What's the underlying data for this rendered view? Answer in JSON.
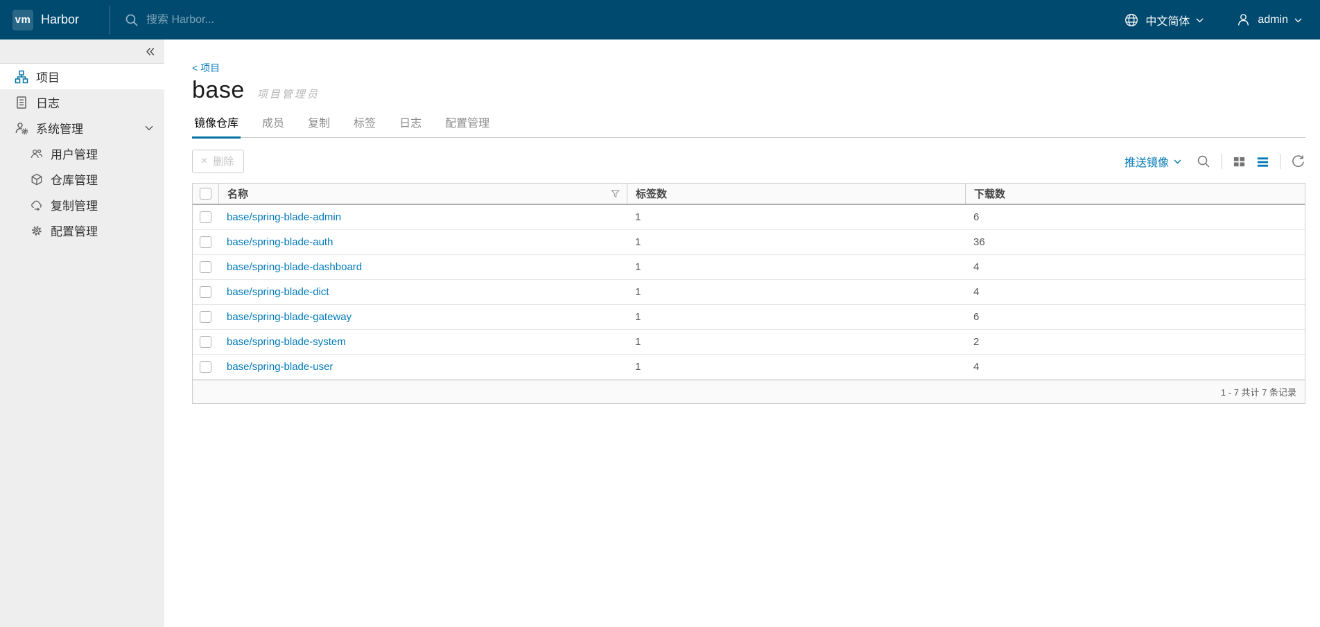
{
  "header": {
    "logo_text": "vm",
    "app_name": "Harbor",
    "search_placeholder": "搜索 Harbor...",
    "language_label": "中文简体",
    "username": "admin"
  },
  "sidebar": {
    "items": [
      {
        "label": "项目",
        "icon": "organization-icon",
        "active": true
      },
      {
        "label": "日志",
        "icon": "log-icon",
        "active": false
      },
      {
        "label": "系统管理",
        "icon": "administration-icon",
        "active": false,
        "expanded": true
      }
    ],
    "sub_items": [
      {
        "label": "用户管理",
        "icon": "users-icon"
      },
      {
        "label": "仓库管理",
        "icon": "registry-icon"
      },
      {
        "label": "复制管理",
        "icon": "replication-icon"
      },
      {
        "label": "配置管理",
        "icon": "config-icon"
      }
    ]
  },
  "page": {
    "breadcrumb": "< 项目",
    "title": "base",
    "role_badge": "项目管理员",
    "tabs": [
      {
        "label": "镜像仓库",
        "active": true
      },
      {
        "label": "成员",
        "active": false
      },
      {
        "label": "复制",
        "active": false
      },
      {
        "label": "标签",
        "active": false
      },
      {
        "label": "日志",
        "active": false
      },
      {
        "label": "配置管理",
        "active": false
      }
    ]
  },
  "toolbar": {
    "delete_label": "删除",
    "push_image_label": "推送镜像"
  },
  "table": {
    "columns": {
      "name": "名称",
      "tags": "标签数",
      "pulls": "下载数"
    },
    "rows": [
      {
        "name": "base/spring-blade-admin",
        "tags": "1",
        "pulls": "6"
      },
      {
        "name": "base/spring-blade-auth",
        "tags": "1",
        "pulls": "36"
      },
      {
        "name": "base/spring-blade-dashboard",
        "tags": "1",
        "pulls": "4"
      },
      {
        "name": "base/spring-blade-dict",
        "tags": "1",
        "pulls": "4"
      },
      {
        "name": "base/spring-blade-gateway",
        "tags": "1",
        "pulls": "6"
      },
      {
        "name": "base/spring-blade-system",
        "tags": "1",
        "pulls": "2"
      },
      {
        "name": "base/spring-blade-user",
        "tags": "1",
        "pulls": "4"
      }
    ],
    "footer_text": "1 - 7 共计 7 条记录"
  },
  "colors": {
    "header_bg": "#004a70",
    "accent": "#0072a3",
    "link": "#0079b8",
    "sidebar_bg": "#eeeeee"
  }
}
